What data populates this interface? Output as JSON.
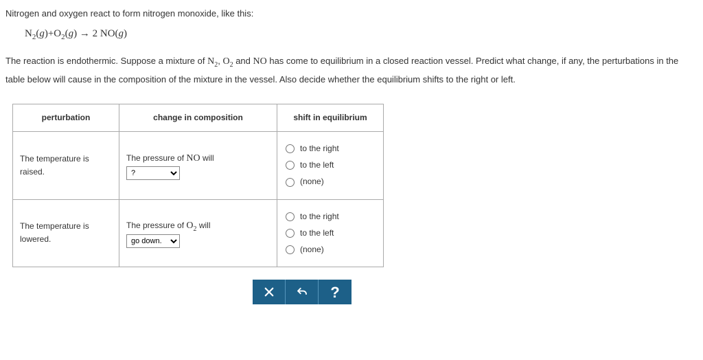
{
  "intro": "Nitrogen and oxygen react to form nitrogen monoxide, like this:",
  "equation_html": "N<span class='sub'>2</span>(<i>g</i>)+O<span class='sub'>2</span>(<i>g</i>) → 2 NO(<i>g</i>)",
  "description_html": "The reaction is endothermic. Suppose a mixture of <span class='chem'>N<span class='sub'>2</span></span>, <span class='chem'>O<span class='sub'>2</span></span> and <span class='chem'>NO</span> has come to equilibrium in a closed reaction vessel. Predict what change, if any, the perturbations in the table below will cause in the composition of the mixture in the vessel. Also decide whether the equilibrium shifts to the right or left.",
  "table": {
    "headers": [
      "perturbation",
      "change in composition",
      "shift in equilibrium"
    ],
    "shift_options": [
      "to the right",
      "to the left",
      "(none)"
    ],
    "rows": [
      {
        "perturbation": "The temperature is raised.",
        "change_label_html": "The pressure of <span class='chem'>NO</span> will",
        "select_value": "?"
      },
      {
        "perturbation": "The temperature is lowered.",
        "change_label_html": "The pressure of <span class='chem'>O<span class='sub'>2</span></span> will",
        "select_value": "go down."
      }
    ]
  },
  "buttons": {
    "close": "×",
    "undo": "↶",
    "help": "?"
  }
}
